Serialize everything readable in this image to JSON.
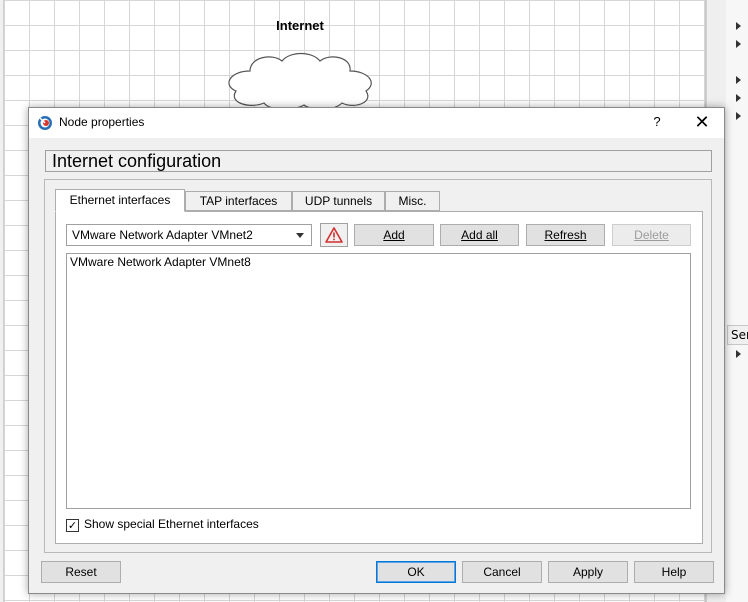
{
  "canvas": {
    "node_label": "Internet",
    "side_panel_tab": "Ser"
  },
  "dialog": {
    "title": "Node properties",
    "help_label": "?",
    "close_label": "✕",
    "config_header": "Internet configuration",
    "tabs": [
      {
        "label": "Ethernet interfaces",
        "active": true
      },
      {
        "label": "TAP interfaces",
        "active": false
      },
      {
        "label": "UDP tunnels",
        "active": false
      },
      {
        "label": "Misc.",
        "active": false
      }
    ],
    "adapter_select": {
      "value": "VMware Network Adapter VMnet2"
    },
    "warning_icon": "warning-triangle-icon",
    "buttons": {
      "add": "Add",
      "add_all": "Add all",
      "refresh": "Refresh",
      "delete": "Delete"
    },
    "interfaces_list": [
      "VMware Network Adapter VMnet8"
    ],
    "show_special": {
      "label": "Show special Ethernet interfaces",
      "checked": true
    },
    "footer": {
      "reset": "Reset",
      "ok": "OK",
      "cancel": "Cancel",
      "apply": "Apply",
      "help": "Help"
    }
  },
  "colors": {
    "warning_red": "#d32f2f",
    "focus_blue": "#0078d7"
  }
}
